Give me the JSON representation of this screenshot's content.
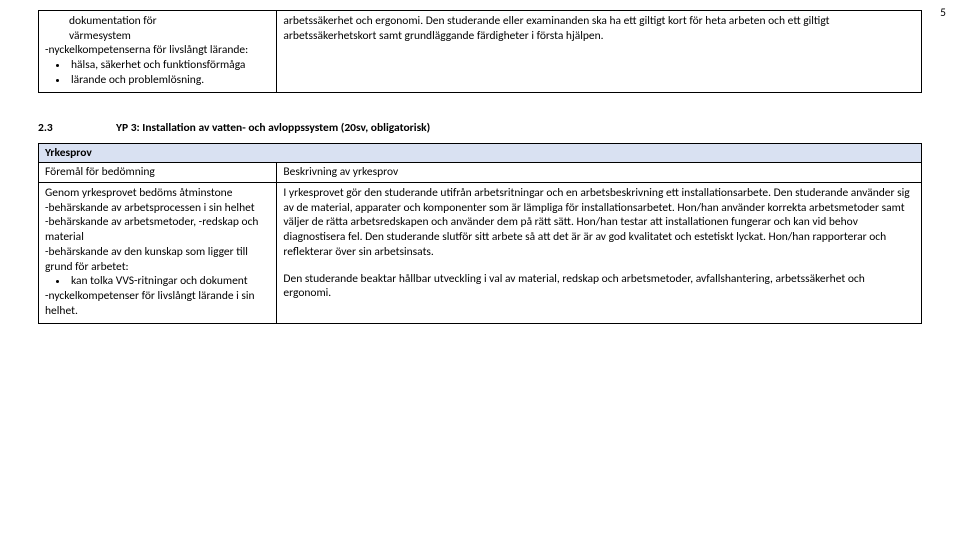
{
  "page_number": "5",
  "top_table": {
    "left_block": {
      "line1": "dokumentation för",
      "line2": "värmesystem",
      "line3": "-nyckelkompetenserna för livslångt lärande:",
      "bullets": [
        "hälsa, säkerhet och funktionsförmåga",
        "lärande och problemlösning."
      ]
    },
    "right_text": "arbetssäkerhet och ergonomi. Den studerande eller examinanden ska ha ett giltigt kort för heta arbeten och ett giltigt arbetssäkerhetskort samt grundläggande färdigheter i första hjälpen."
  },
  "section": {
    "number": "2.3",
    "title": "YP 3: Installation av vatten- och avloppssystem (20sv, obligatorisk)"
  },
  "main_table": {
    "header_label": "Yrkesprov",
    "left_header": "Föremål för bedömning",
    "right_header": "Beskrivning av yrkesprov",
    "left_body": {
      "l1": "Genom yrkesprovet bedöms åtminstone",
      "l2": "-behärskande av arbetsprocessen i sin helhet",
      "l3": "-behärskande av arbetsmetoder, -redskap och material",
      "l4": "-behärskande av den kunskap som ligger till grund för arbetet:",
      "bullets": [
        "kan tolka VVS-ritningar och dokument"
      ],
      "l5": "-nyckelkompetenser för livslångt lärande i sin helhet."
    },
    "right_body": {
      "p1": "I yrkesprovet gör den studerande utifrån arbetsritningar och en arbetsbeskrivning ett installationsarbete. Den studerande använder sig av de material, apparater och komponenter som är lämpliga för installationsarbetet. Hon/han använder korrekta arbetsmetoder samt väljer de rätta arbetsredskapen och använder dem på rätt sätt. Hon/han testar att installationen fungerar och kan vid behov diagnostisera fel. Den studerande slutför sitt arbete så att det är är av god kvalitatet och estetiskt lyckat. Hon/han rapporterar och reflekterar över sin arbetsinsats.",
      "p2": "Den studerande beaktar hållbar utveckling i val av material, redskap och arbetsmetoder, avfallshantering, arbetssäkerhet och ergonomi."
    }
  }
}
